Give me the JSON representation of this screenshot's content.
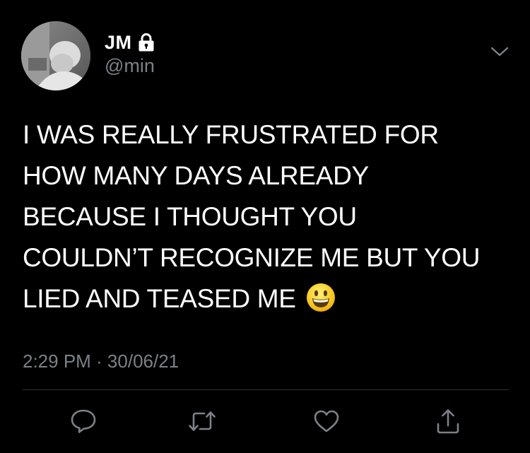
{
  "user": {
    "display_name": "JM",
    "handle": "@min",
    "protected_icon": "lock-icon",
    "avatar": "grayscale profile photo"
  },
  "tweet": {
    "lines": [
      "I WAS REALLY FRUSTRATED FOR",
      "HOW MANY DAYS ALREADY",
      "BECAUSE I THOUGHT YOU",
      "COULDN’T RECOGNIZE ME BUT YOU",
      "LIED AND TEASED ME"
    ],
    "emoji": "grinning-face-emoji",
    "timestamp": "2:29 PM · 30/06/21"
  },
  "actions": [
    {
      "name": "reply",
      "icon": "comment-bubble-icon"
    },
    {
      "name": "retweet",
      "icon": "retweet-icon"
    },
    {
      "name": "like",
      "icon": "heart-icon"
    },
    {
      "name": "share",
      "icon": "share-icon"
    }
  ],
  "colors": {
    "background": "#000000",
    "text": "#ffffff",
    "secondary": "#7b8187",
    "divider": "#2f3336"
  }
}
